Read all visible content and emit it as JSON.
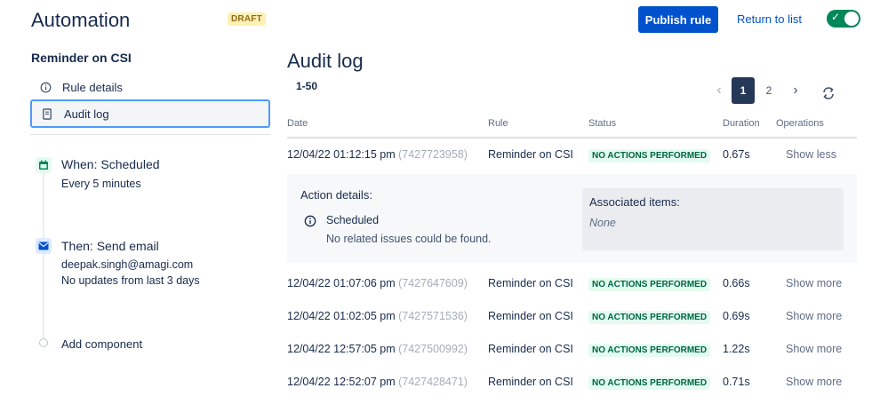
{
  "header": {
    "title": "Automation",
    "draft_badge": "DRAFT",
    "publish_label": "Publish rule",
    "return_label": "Return to list",
    "toggle_on": true
  },
  "sidebar": {
    "rule_name": "Reminder on CSI",
    "items": [
      {
        "label": "Rule details",
        "icon": "info-icon",
        "active": false
      },
      {
        "label": "Audit log",
        "icon": "document-icon",
        "active": true
      }
    ],
    "trigger": {
      "title": "When: Scheduled",
      "sub": "Every 5 minutes",
      "icon": "calendar-icon"
    },
    "action": {
      "title": "Then: Send email",
      "sub1": "deepak.singh@amagi.com",
      "sub2": "No updates from last 3 days",
      "icon": "mail-icon"
    },
    "add_component": "Add component"
  },
  "main": {
    "title": "Audit log",
    "range": "1-50",
    "pagination": {
      "pages": [
        "1",
        "2"
      ],
      "current": "1"
    },
    "columns": {
      "date": "Date",
      "rule": "Rule",
      "status": "Status",
      "duration": "Duration",
      "operations": "Operations"
    },
    "rows": [
      {
        "date": "12/04/22 01:12:15 pm",
        "id": "(7427723958)",
        "rule": "Reminder on CSI",
        "status": "NO ACTIONS PERFORMED",
        "duration": "0.67s",
        "op": "Show less"
      },
      {
        "date": "12/04/22 01:07:06 pm",
        "id": "(7427647609)",
        "rule": "Reminder on CSI",
        "status": "NO ACTIONS PERFORMED",
        "duration": "0.66s",
        "op": "Show more"
      },
      {
        "date": "12/04/22 01:02:05 pm",
        "id": "(7427571536)",
        "rule": "Reminder on CSI",
        "status": "NO ACTIONS PERFORMED",
        "duration": "0.69s",
        "op": "Show more"
      },
      {
        "date": "12/04/22 12:57:05 pm",
        "id": "(7427500992)",
        "rule": "Reminder on CSI",
        "status": "NO ACTIONS PERFORMED",
        "duration": "1.22s",
        "op": "Show more"
      },
      {
        "date": "12/04/22 12:52:07 pm",
        "id": "(7427428471)",
        "rule": "Reminder on CSI",
        "status": "NO ACTIONS PERFORMED",
        "duration": "0.71s",
        "op": "Show more"
      }
    ],
    "details": {
      "action_title": "Action details:",
      "action_name": "Scheduled",
      "action_note": "No related issues could be found.",
      "assoc_title": "Associated items:",
      "assoc_value": "None"
    }
  },
  "colors": {
    "primary": "#0052cc",
    "toggle_on": "#00875a",
    "lozenge_bg": "#e3fcef",
    "lozenge_text": "#006644",
    "draft_bg": "#fff0b3"
  }
}
